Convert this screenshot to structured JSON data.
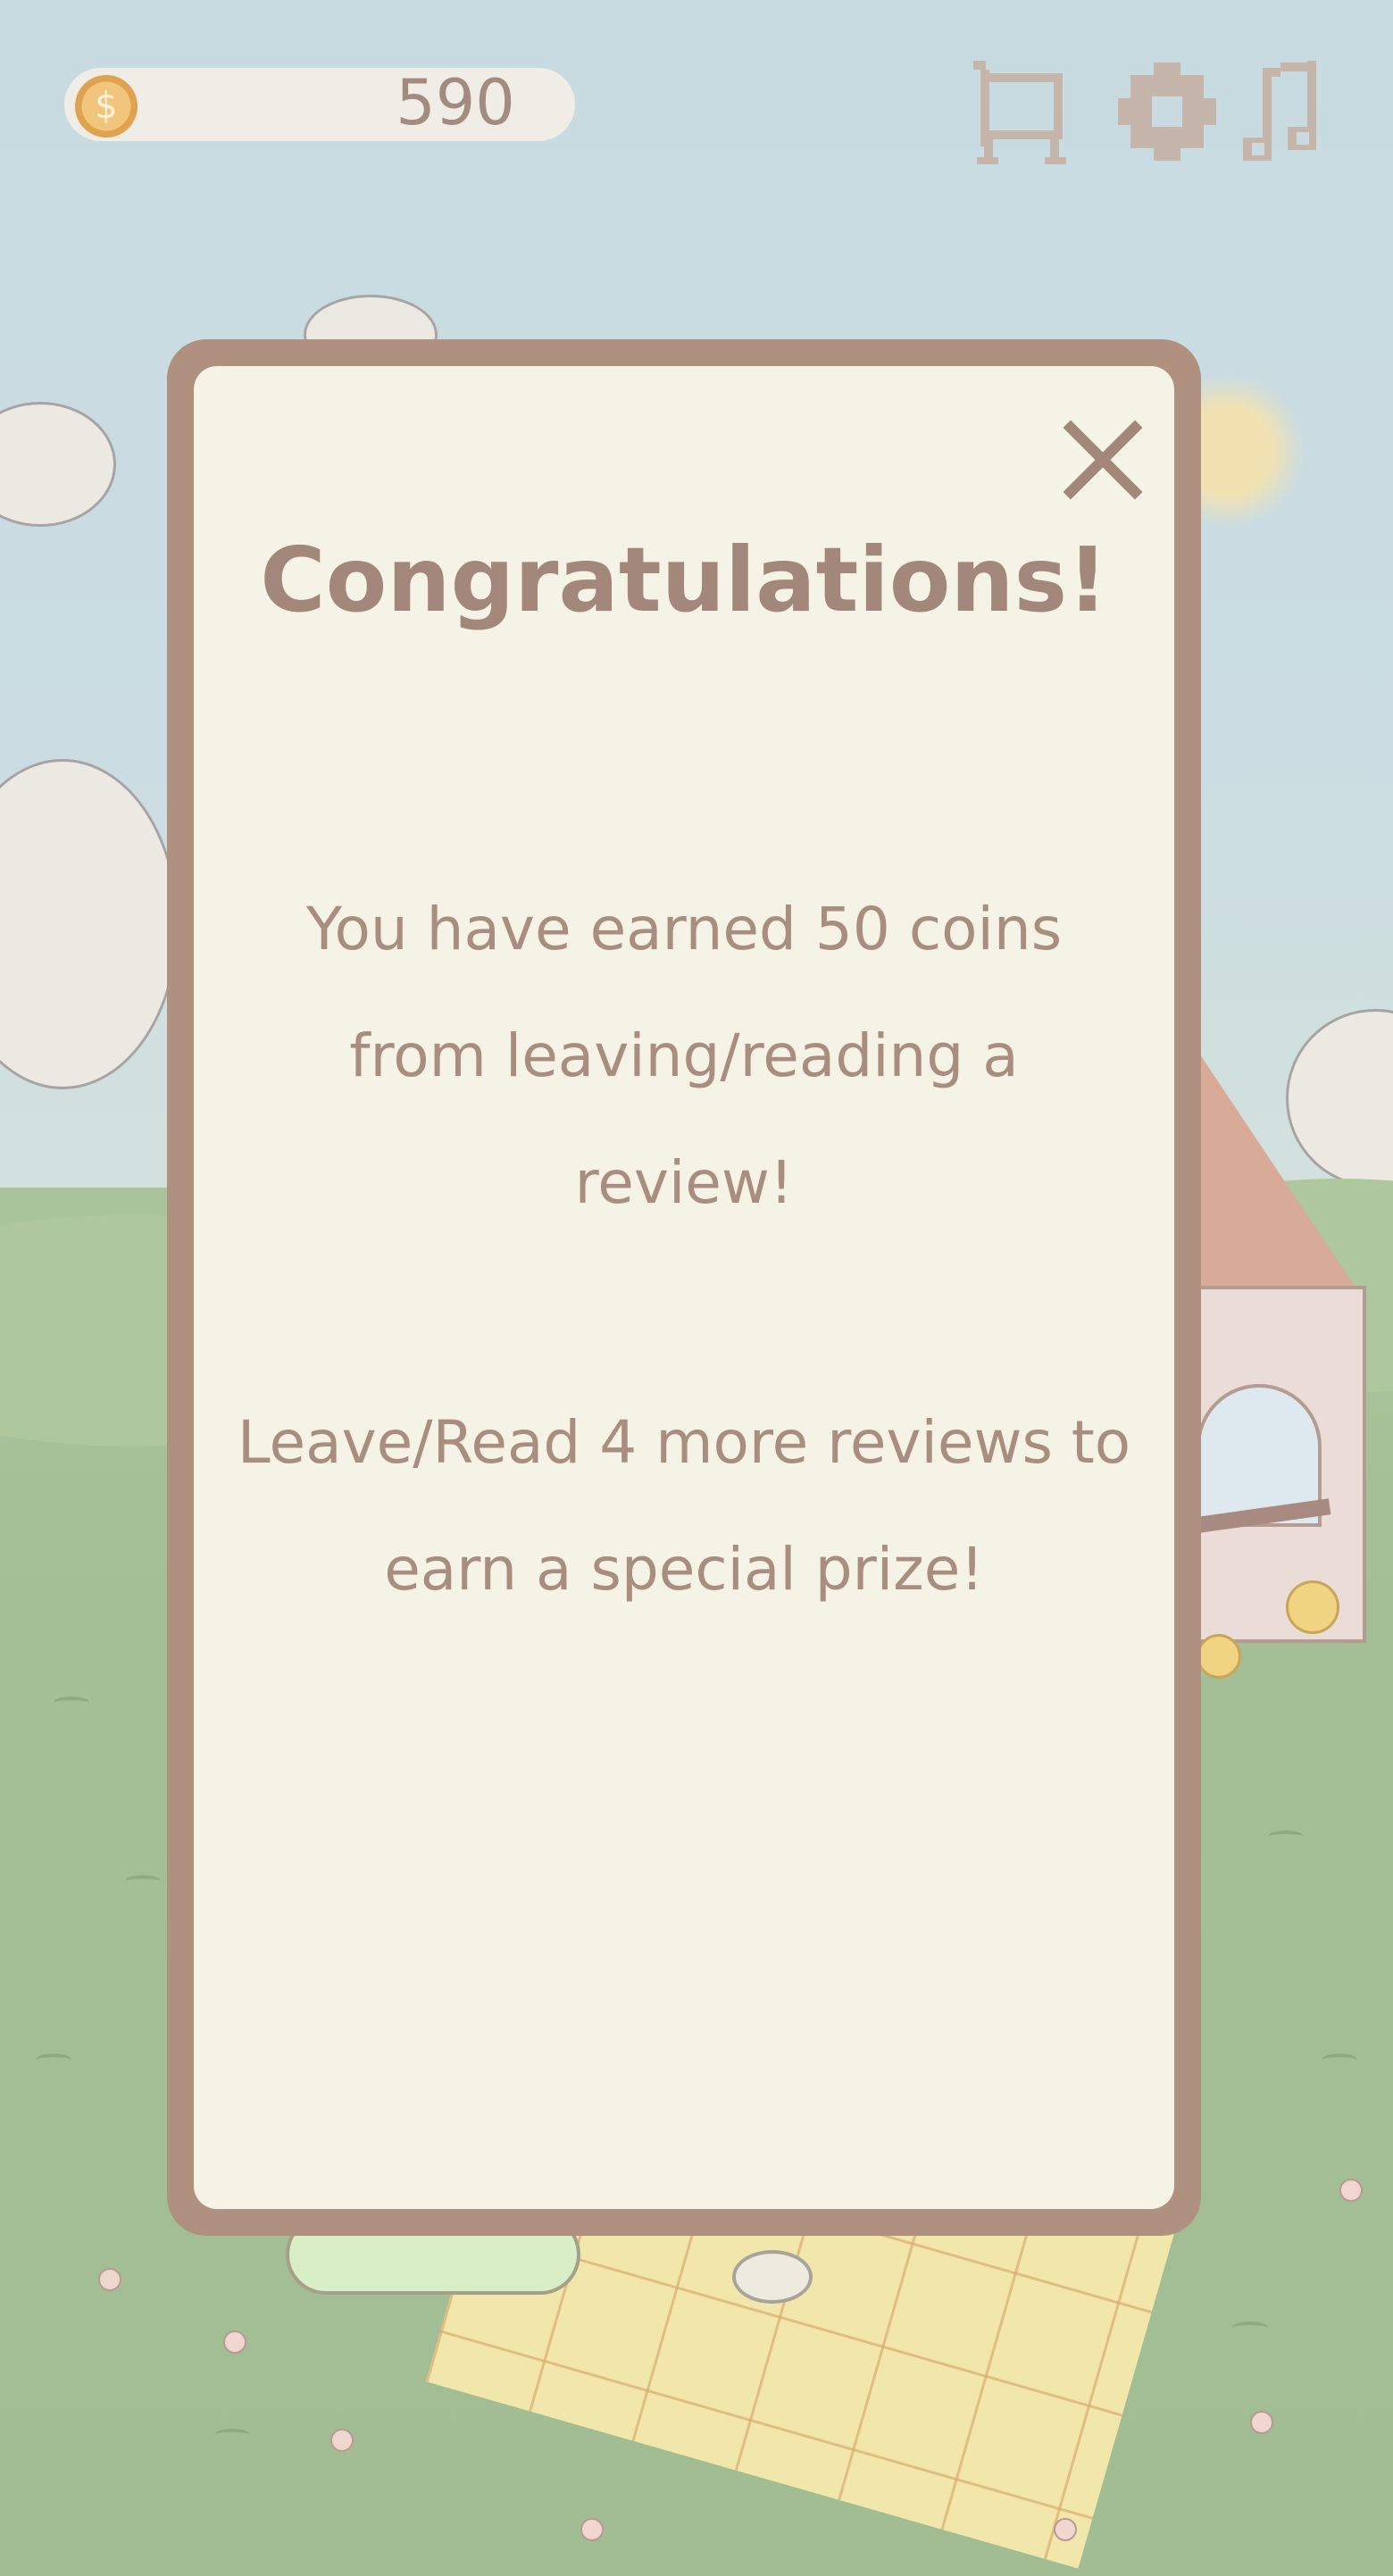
{
  "hud": {
    "coin_symbol": "$",
    "coin_count": "590",
    "icons": [
      "coin-icon",
      "shop-cart-icon",
      "settings-gear-icon",
      "music-note-icon"
    ]
  },
  "popup": {
    "close_icon": "close-icon",
    "title": "Congratulations!",
    "message_earned": "You have earned 50 coins from leaving/reading a review!",
    "message_remaining": "Leave/Read 4 more reviews to earn a special prize!"
  },
  "colors": {
    "frame": "#b0917f",
    "panel": "#f5f3e6",
    "text": "#a98e80",
    "sky": "#c8dbe1",
    "grass": "#a4bf95"
  }
}
